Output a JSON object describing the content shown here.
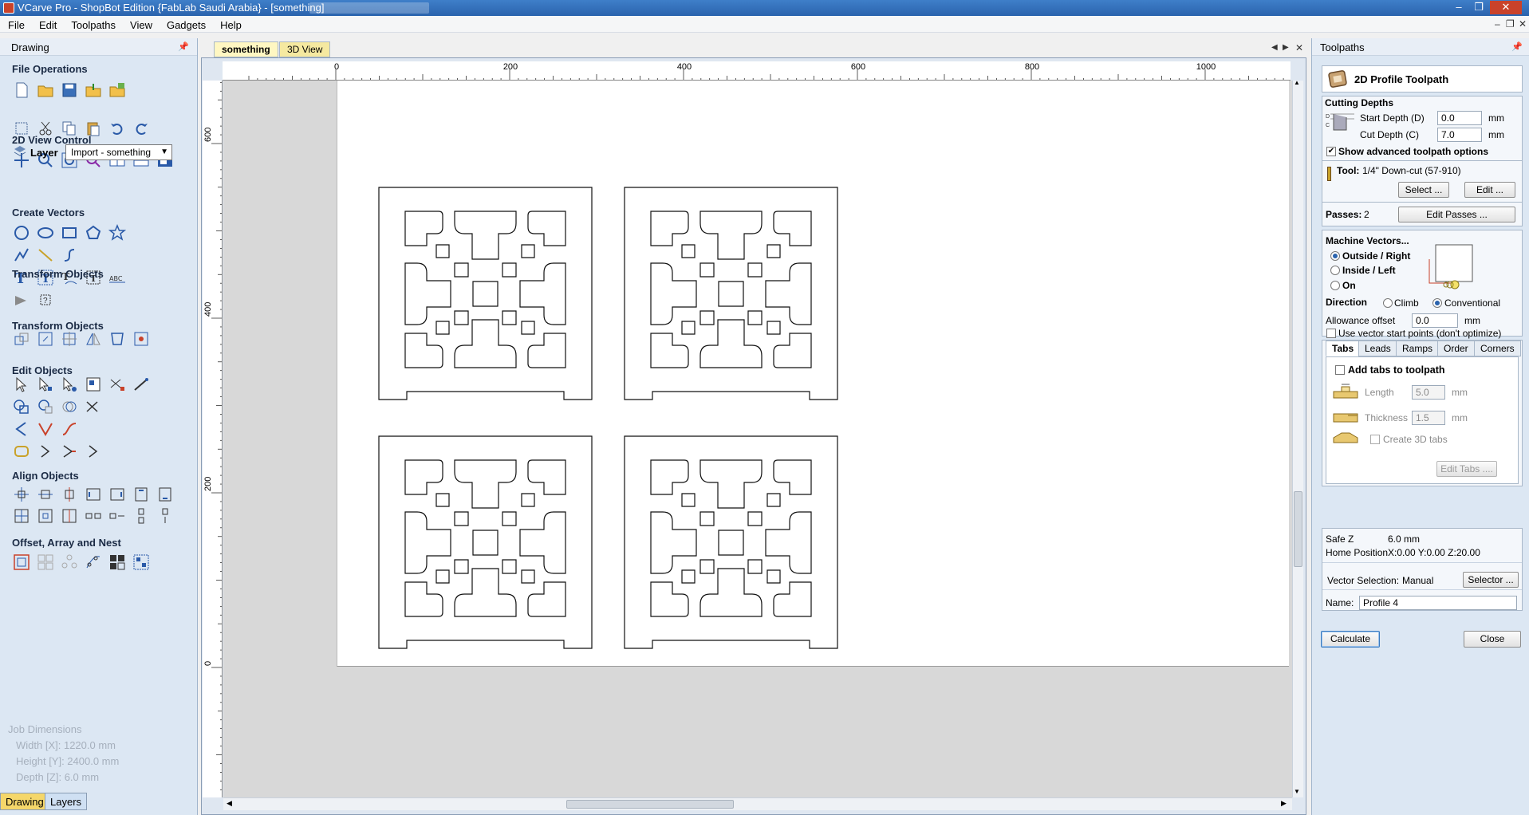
{
  "window": {
    "title": "VCarve Pro - ShopBot Edition {FabLab Saudi Arabia} - [something]",
    "controls": [
      "–",
      "❐",
      "✕"
    ]
  },
  "menu": [
    "File",
    "Edit",
    "Toolpaths",
    "View",
    "Gadgets",
    "Help"
  ],
  "left_panel": {
    "title": "Drawing",
    "sections": {
      "file_operations": "File Operations",
      "view_control": "2D View Control",
      "create_vectors": "Create Vectors",
      "transform_objects": "Transform Objects",
      "edit_objects": "Edit Objects",
      "align_objects": "Align Objects",
      "offset_array_nest": "Offset, Array and Nest"
    },
    "layer_label": "Layer",
    "layer_value": "Import - something",
    "job_dimensions": {
      "title": "Job Dimensions",
      "width": "Width  [X]: 1220.0 mm",
      "height": "Height [Y]: 2400.0 mm",
      "depth": "Depth  [Z]: 6.0 mm"
    },
    "bottom_tabs": [
      "Drawing",
      "Layers"
    ]
  },
  "doc_tabs": [
    "something",
    "3D View"
  ],
  "rulers": {
    "h_ticks": [
      "0",
      "200",
      "400",
      "600",
      "800",
      "1000"
    ],
    "v_ticks": [
      "600",
      "400",
      "200",
      "0"
    ]
  },
  "right_panel": {
    "title": "Toolpaths",
    "heading": "2D Profile Toolpath",
    "cutting_depths": {
      "title": "Cutting Depths",
      "start_label": "Start Depth (D)",
      "start_value": "0.0",
      "cut_label": "Cut Depth (C)",
      "cut_value": "7.0",
      "unit": "mm",
      "depth_diagram_d": "D",
      "depth_diagram_c": "C",
      "show_advanced": "Show advanced toolpath options"
    },
    "tool": {
      "label": "Tool:",
      "value": "1/4\"  Down-cut (57-910)",
      "select": "Select ...",
      "edit": "Edit ...",
      "passes_label": "Passes:",
      "passes_value": "2",
      "edit_passes": "Edit Passes ..."
    },
    "machine_vectors": {
      "title": "Machine Vectors...",
      "outside": "Outside / Right",
      "inside": "Inside / Left",
      "on": "On",
      "direction": "Direction",
      "climb": "Climb",
      "conventional": "Conventional",
      "allowance_label": "Allowance offset",
      "allowance_value": "0.0",
      "unit": "mm",
      "use_start_points": "Use vector start points (don't optimize)"
    },
    "tabs": {
      "labels": [
        "Tabs",
        "Leads",
        "Ramps",
        "Order",
        "Corners"
      ],
      "add_tabs": "Add tabs to toolpath",
      "length_label": "Length",
      "length_value": "5.0",
      "thickness_label": "Thickness",
      "thickness_value": "1.5",
      "unit": "mm",
      "create_3d": "Create 3D tabs",
      "edit_tabs": "Edit Tabs ...."
    },
    "safe_z_label": "Safe Z",
    "safe_z_value": "6.0 mm",
    "home_label": "Home Position",
    "home_value": "X:0.00 Y:0.00 Z:20.00",
    "vector_selection_label": "Vector Selection:",
    "vector_selection_value": "Manual",
    "selector": "Selector ...",
    "name_label": "Name:",
    "name_value": "Profile 4",
    "calculate": "Calculate",
    "close": "Close"
  },
  "colors": {
    "panel_bg": "#dce7f3",
    "title_bar": "#2a63ad",
    "tab_active": "#fff7c2",
    "canvas_bg": "#d8d8d8"
  }
}
